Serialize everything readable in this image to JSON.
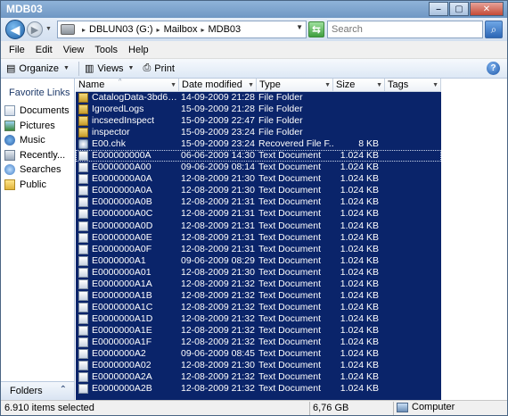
{
  "window": {
    "title": "MDB03",
    "minimize_label": "–",
    "maximize_label": "▢",
    "close_label": "✕"
  },
  "address": {
    "crumbs": [
      "DBLUN03 (G:)",
      "Mailbox",
      "MDB03"
    ],
    "search_placeholder": "Search"
  },
  "menu": [
    "File",
    "Edit",
    "View",
    "Tools",
    "Help"
  ],
  "toolbar": {
    "organize": "Organize",
    "views": "Views",
    "print": "Print",
    "help": "?"
  },
  "nav": {
    "header": "Favorite Links",
    "items": [
      "Documents",
      "Pictures",
      "Music",
      "Recently...",
      "Searches",
      "Public"
    ],
    "icons": [
      "documents-icon",
      "pictures-icon",
      "music-icon",
      "recent-icon",
      "searches-icon",
      "public-icon"
    ],
    "folders_label": "Folders",
    "folders_chevron": "⌃"
  },
  "columns": [
    "Name",
    "Date modified",
    "Type",
    "Size",
    "Tags"
  ],
  "files": [
    {
      "name": "CatalogData-3bd6a2...",
      "date": "14-09-2009 21:28",
      "type": "File Folder",
      "size": "",
      "icon": "folder"
    },
    {
      "name": "IgnoredLogs",
      "date": "15-09-2009 21:28",
      "type": "File Folder",
      "size": "",
      "icon": "folder"
    },
    {
      "name": "incseedInspect",
      "date": "15-09-2009 22:47",
      "type": "File Folder",
      "size": "",
      "icon": "folder"
    },
    {
      "name": "inspector",
      "date": "15-09-2009 23:24",
      "type": "File Folder",
      "size": "",
      "icon": "folder"
    },
    {
      "name": "E00.chk",
      "date": "15-09-2009 23:24",
      "type": "Recovered File F...",
      "size": "8 KB",
      "icon": "chk"
    },
    {
      "name": "E000000000A",
      "date": "06-06-2009 14:30",
      "type": "Text Document",
      "size": "1.024 KB",
      "icon": "text"
    },
    {
      "name": "E0000000A00",
      "date": "09-06-2009 08:14",
      "type": "Text Document",
      "size": "1.024 KB",
      "icon": "text"
    },
    {
      "name": "E0000000A0A",
      "date": "12-08-2009 21:30",
      "type": "Text Document",
      "size": "1.024 KB",
      "icon": "text"
    },
    {
      "name": "E0000000A0A",
      "date": "12-08-2009 21:30",
      "type": "Text Document",
      "size": "1.024 KB",
      "icon": "text"
    },
    {
      "name": "E0000000A0B",
      "date": "12-08-2009 21:31",
      "type": "Text Document",
      "size": "1.024 KB",
      "icon": "text"
    },
    {
      "name": "E0000000A0C",
      "date": "12-08-2009 21:31",
      "type": "Text Document",
      "size": "1.024 KB",
      "icon": "text"
    },
    {
      "name": "E0000000A0D",
      "date": "12-08-2009 21:31",
      "type": "Text Document",
      "size": "1.024 KB",
      "icon": "text"
    },
    {
      "name": "E0000000A0E",
      "date": "12-08-2009 21:31",
      "type": "Text Document",
      "size": "1.024 KB",
      "icon": "text"
    },
    {
      "name": "E0000000A0F",
      "date": "12-08-2009 21:31",
      "type": "Text Document",
      "size": "1.024 KB",
      "icon": "text"
    },
    {
      "name": "E0000000A1",
      "date": "09-06-2009 08:29",
      "type": "Text Document",
      "size": "1.024 KB",
      "icon": "text"
    },
    {
      "name": "E0000000A01",
      "date": "12-08-2009 21:30",
      "type": "Text Document",
      "size": "1.024 KB",
      "icon": "text"
    },
    {
      "name": "E0000000A1A",
      "date": "12-08-2009 21:32",
      "type": "Text Document",
      "size": "1.024 KB",
      "icon": "text"
    },
    {
      "name": "E0000000A1B",
      "date": "12-08-2009 21:32",
      "type": "Text Document",
      "size": "1.024 KB",
      "icon": "text"
    },
    {
      "name": "E0000000A1C",
      "date": "12-08-2009 21:32",
      "type": "Text Document",
      "size": "1.024 KB",
      "icon": "text"
    },
    {
      "name": "E0000000A1D",
      "date": "12-08-2009 21:32",
      "type": "Text Document",
      "size": "1.024 KB",
      "icon": "text"
    },
    {
      "name": "E0000000A1E",
      "date": "12-08-2009 21:32",
      "type": "Text Document",
      "size": "1.024 KB",
      "icon": "text"
    },
    {
      "name": "E0000000A1F",
      "date": "12-08-2009 21:32",
      "type": "Text Document",
      "size": "1.024 KB",
      "icon": "text"
    },
    {
      "name": "E0000000A2",
      "date": "09-06-2009 08:45",
      "type": "Text Document",
      "size": "1.024 KB",
      "icon": "text"
    },
    {
      "name": "E0000000A02",
      "date": "12-08-2009 21:30",
      "type": "Text Document",
      "size": "1.024 KB",
      "icon": "text"
    },
    {
      "name": "E0000000A2A",
      "date": "12-08-2009 21:32",
      "type": "Text Document",
      "size": "1.024 KB",
      "icon": "text"
    },
    {
      "name": "E0000000A2B",
      "date": "12-08-2009 21:32",
      "type": "Text Document",
      "size": "1.024 KB",
      "icon": "text"
    }
  ],
  "focused_row": 5,
  "status": {
    "selected": "6.910 items selected",
    "size": "6,76 GB",
    "location": "Computer"
  },
  "colors": {
    "selection": "#0a246a",
    "titlebar": "#7aa0cb"
  }
}
